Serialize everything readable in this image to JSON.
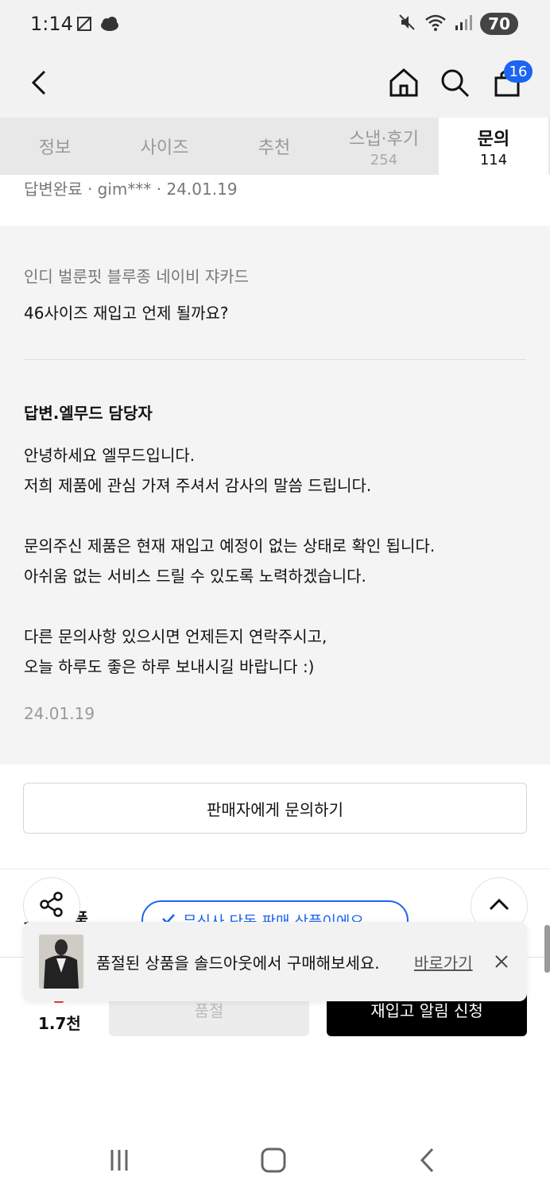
{
  "status_bar": {
    "time": "1:14",
    "battery": "70",
    "icons": [
      "nfc-icon",
      "cloud-icon",
      "mute-icon",
      "wifi-icon",
      "signal-icon"
    ]
  },
  "header": {
    "cart_count": "16",
    "icons": [
      "back-icon",
      "home-icon",
      "search-icon",
      "bag-icon"
    ]
  },
  "tabs": [
    {
      "label": "정보",
      "count": ""
    },
    {
      "label": "사이즈",
      "count": ""
    },
    {
      "label": "추천",
      "count": ""
    },
    {
      "label": "스냅·후기",
      "count": "254"
    },
    {
      "label": "문의",
      "count": "114"
    }
  ],
  "previous_inquiry_meta": "답변완료 · gim*** · 24.01.19",
  "inquiry": {
    "product_name": "인디 벌룬핏 블루종 네이비 쟈카드",
    "question": "46사이즈 재입고 언제 될까요?",
    "answer_title": "답변.엘무드 담당자",
    "answer_lines": [
      "안녕하세요 엘무드입니다.",
      "저희 제품에 관심 가져 주셔서 감사의 말씀 드립니다.",
      "",
      "문의주신 제품은 현재 재입고 예정이 없는 상태로 확인 됩니다.",
      "아쉬움 없는 서비스 드릴 수 있도록 노력하겠습니다.",
      "",
      "다른 문의사항 있으시면 언제든지 연락주시고,",
      "오늘 하루도 좋은 하루 보내시길 바랍니다 :)"
    ],
    "answer_date": "24.01.19"
  },
  "inquiry_button": "판매자에게 문의하기",
  "exchange_section": {
    "label": "교환/반품",
    "pill_text": "무신사 단독 판매 상품이에요"
  },
  "toast": {
    "message": "품절된 상품을 솔드아웃에서 구매해보세요.",
    "link": "바로가기"
  },
  "bottom_bar": {
    "like_count": "1.7천",
    "soldout_label": "품절",
    "restock_label": "재입고 알림 신청"
  },
  "colors": {
    "accent_blue": "#1c64f2",
    "header_bg": "#f2f2f2",
    "panel_bg": "#f4f4f4"
  }
}
